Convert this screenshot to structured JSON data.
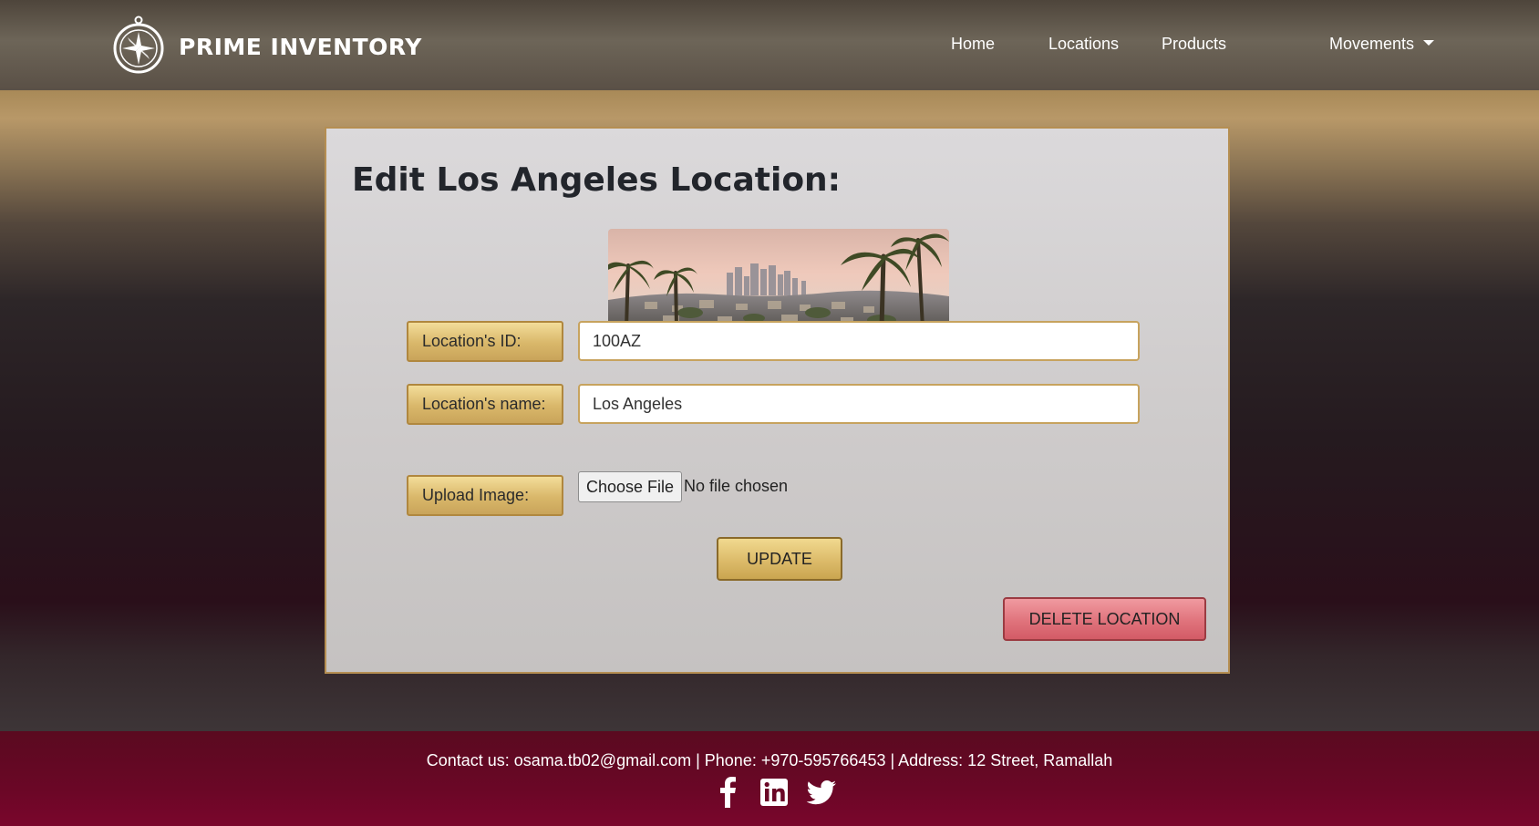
{
  "navbar": {
    "brand": "PRIME INVENTORY",
    "logo_icon": "compass-logo",
    "links": {
      "home": "Home",
      "locations": "Locations",
      "products": "Products",
      "movements": "Movements"
    }
  },
  "form": {
    "title": "Edit Los Angeles Location:",
    "image_alt": "Los Angeles skyline with palm trees",
    "id_label": "Location's ID:",
    "id_value": "100AZ",
    "name_label": "Location's name:",
    "name_value": "Los Angeles",
    "upload_label": "Upload Image:",
    "choose_file": "Choose File",
    "file_status": "No file chosen",
    "update_button": "UPDATE",
    "delete_button": "DELETE LOCATION"
  },
  "footer": {
    "contact": "Contact us: osama.tb02@gmail.com | Phone: +970-595766453 | Address: 12 Street, Ramallah",
    "social_icons": [
      "facebook-icon",
      "linkedin-icon",
      "twitter-icon"
    ]
  },
  "colors": {
    "accent_gold": "#d9b76a",
    "delete_red": "#e0737c",
    "footer_maroon": "#6a0726"
  }
}
